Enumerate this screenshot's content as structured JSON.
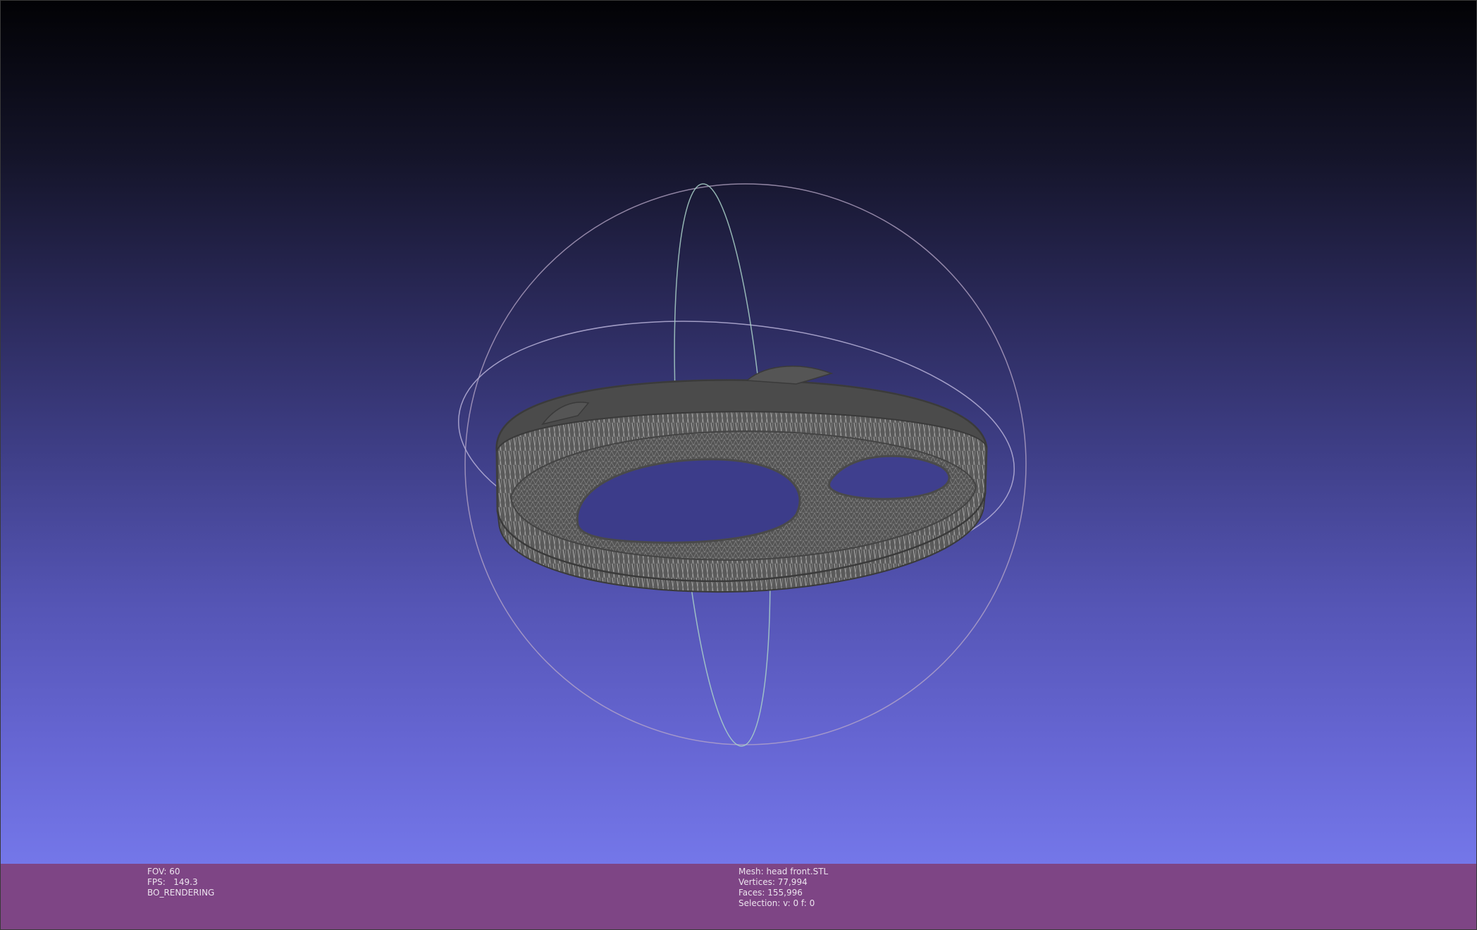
{
  "viewport": {
    "gradient_top": "#020205",
    "gradient_bottom": "#7477e9",
    "mesh_color": "#505050",
    "trackball_colors": {
      "horizontal": "#b7b2d8",
      "vertical": "#a9d0c8",
      "outer": "#b8a8c8"
    }
  },
  "info_left": {
    "fov": "FOV: 60",
    "fps": "FPS:   149.3",
    "mode": "BO_RENDERING"
  },
  "info_right": {
    "mesh": "Mesh: head front.STL",
    "vertices": "Vertices: 77,994",
    "faces": "Faces: 155,996",
    "selection": "Selection: v: 0 f: 0"
  },
  "info_bar_color": "#7e4585"
}
